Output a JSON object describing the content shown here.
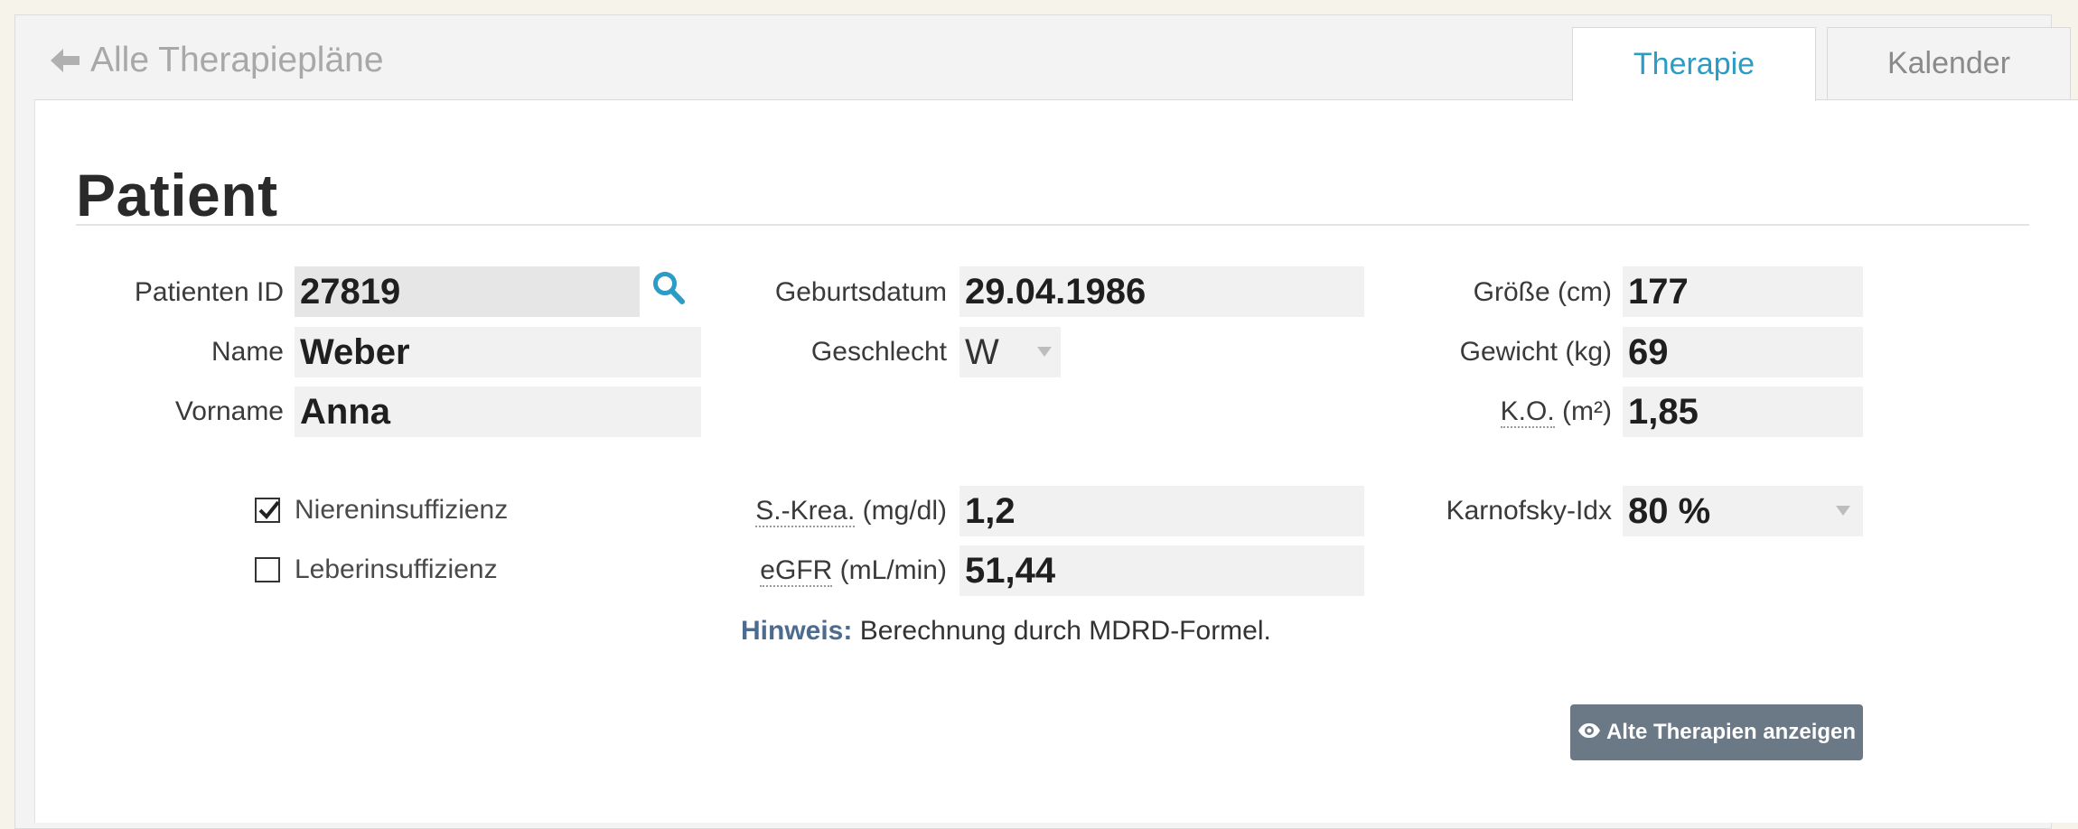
{
  "nav": {
    "back_label": "Alle Therapiepläne"
  },
  "tabs": [
    {
      "label": "Therapie",
      "active": true
    },
    {
      "label": "Kalender",
      "active": false
    }
  ],
  "page": {
    "title": "Patient"
  },
  "patient": {
    "id": {
      "label": "Patienten ID",
      "value": "27819"
    },
    "name": {
      "label": "Name",
      "value": "Weber"
    },
    "vorname": {
      "label": "Vorname",
      "value": "Anna"
    },
    "birthdate": {
      "label": "Geburtsdatum",
      "value": "29.04.1986"
    },
    "gender": {
      "label": "Geschlecht",
      "value": "W"
    },
    "height": {
      "label": "Größe (cm)",
      "value": "177"
    },
    "weight": {
      "label": "Gewicht (kg)",
      "value": "69"
    },
    "ko": {
      "label_abbr": "K.O.",
      "label_unit": "(m²)",
      "value": "1,85"
    }
  },
  "conditions": {
    "renal": {
      "label": "Niereninsuffizienz",
      "checked": true
    },
    "hepatic": {
      "label": "Leberinsuffizienz",
      "checked": false
    }
  },
  "labs": {
    "skrea": {
      "label_abbr": "S.-Krea.",
      "label_unit": "(mg/dl)",
      "value": "1,2"
    },
    "egfr": {
      "label_abbr": "eGFR",
      "label_unit": "(mL/min)",
      "value": "51,44"
    },
    "karnofsky": {
      "label": "Karnofsky-Idx",
      "value": "80 %"
    }
  },
  "hint": {
    "label": "Hinweis:",
    "text": "Berechnung durch MDRD-Formel."
  },
  "actions": {
    "show_old_label": "Alte Therapien anzeigen"
  },
  "colors": {
    "accent": "#2a9cc6",
    "hint": "#4c6b8f",
    "button": "#6b7885",
    "field_bg": "#f1f1f1"
  }
}
